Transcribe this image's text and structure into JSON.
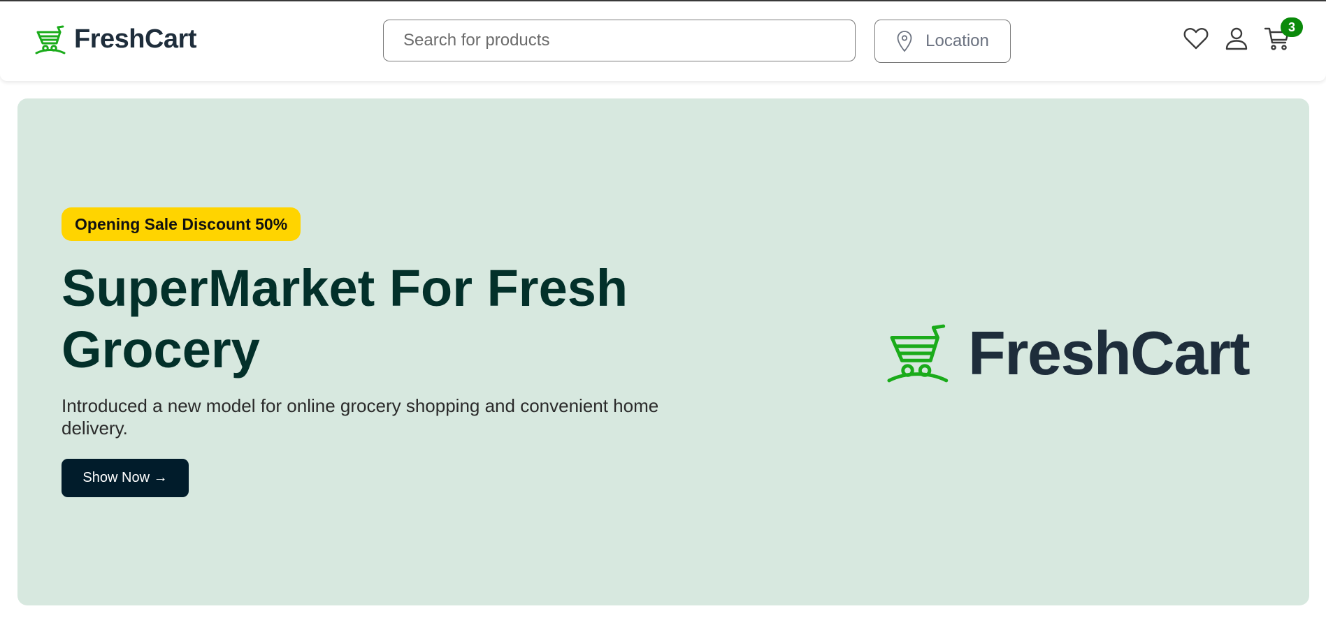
{
  "header": {
    "brand_name": "FreshCart",
    "search_placeholder": "Search for products",
    "location_label": "Location",
    "cart_count": "3",
    "icons": [
      "cart-logo-icon",
      "map-pin-icon",
      "heart-icon",
      "user-icon",
      "shopping-cart-icon"
    ]
  },
  "hero": {
    "badge": "Opening Sale Discount 50%",
    "title": "SuperMarket For Fresh Grocery",
    "subtitle": "Introduced a new model for online grocery shopping and convenient home delivery.",
    "cta_label": "Show Now →",
    "logo_text": "FreshCart"
  },
  "colors": {
    "brand_green": "#1aab1a",
    "brand_text": "#1e2d3b",
    "hero_bg": "#d7e8df",
    "promo_bg": "#ffd400",
    "cta_bg": "#011c2b",
    "badge_bg": "#0a8a0a"
  }
}
